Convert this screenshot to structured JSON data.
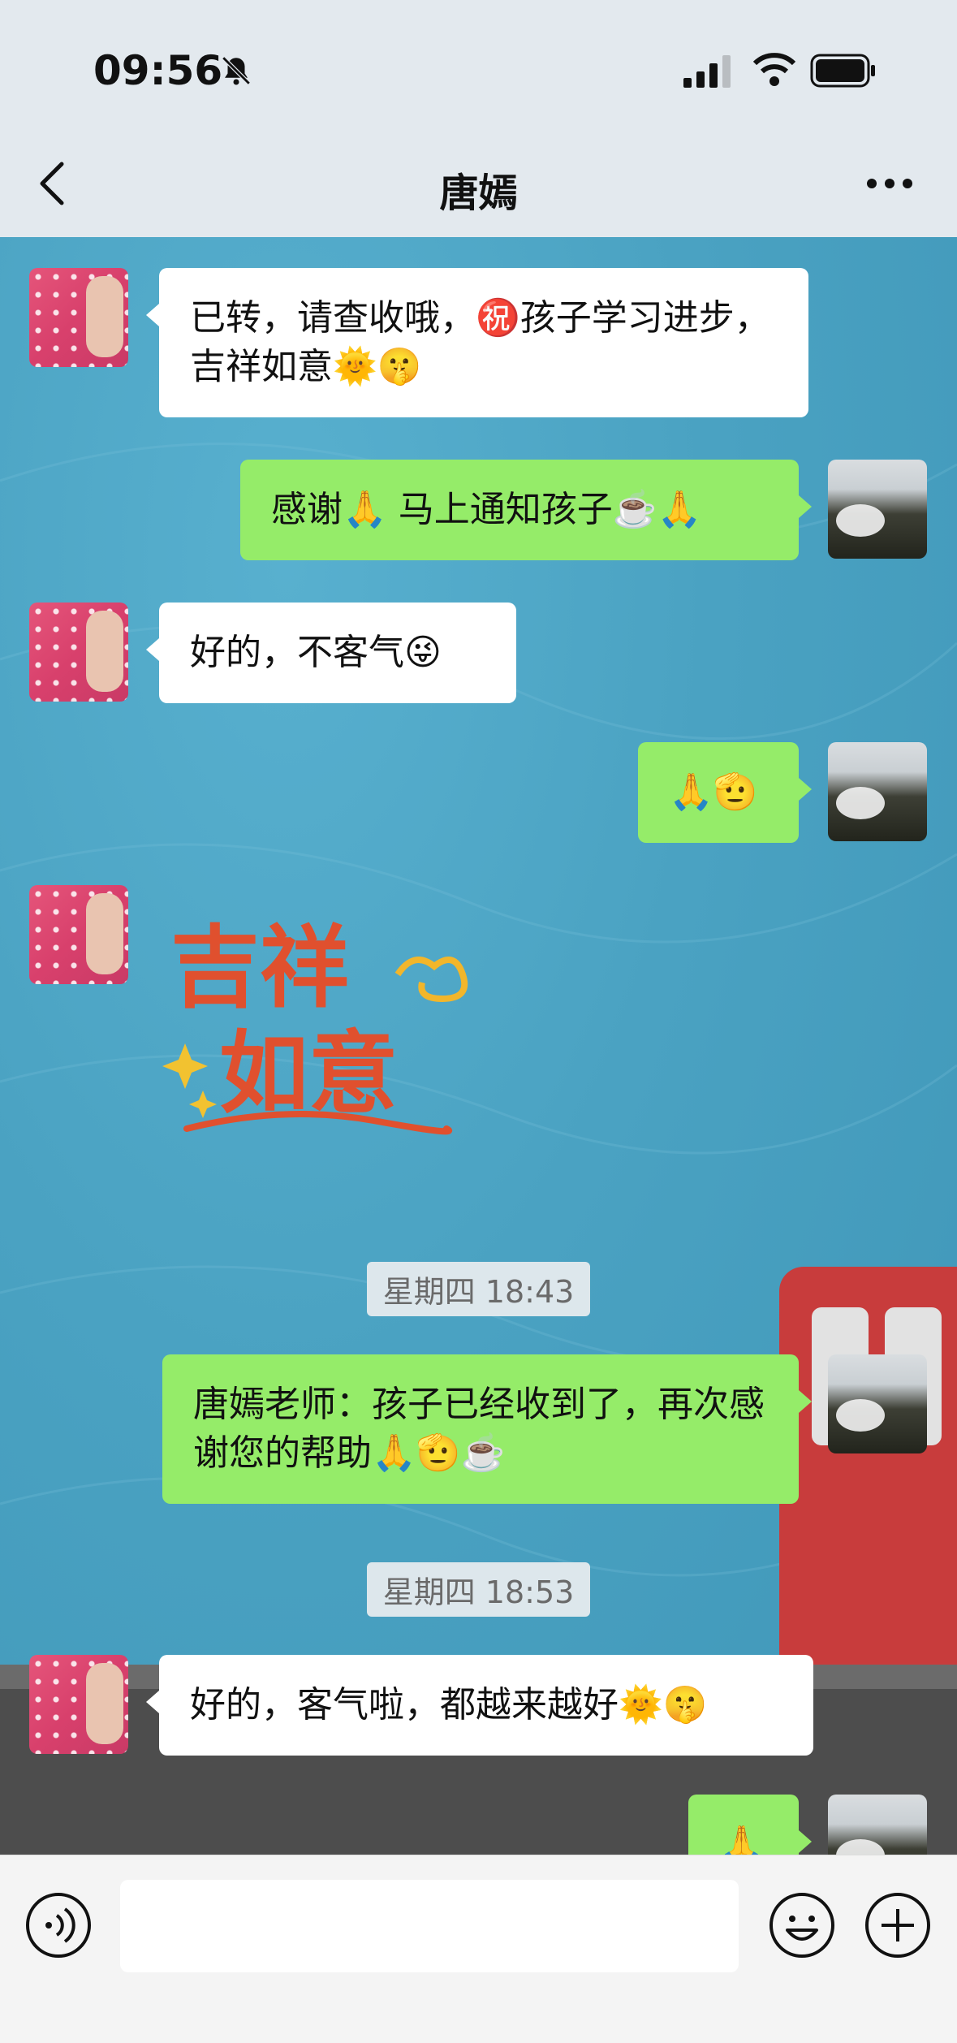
{
  "status_bar": {
    "time": "09:56"
  },
  "header": {
    "title": "唐嫣"
  },
  "messages": [
    {
      "side": "left",
      "text": "已转，请查收哦，㊗️孩子学习进步，吉祥如意🌞🤫"
    },
    {
      "side": "right",
      "text": "感谢🙏 马上通知孩子☕️🙏"
    },
    {
      "side": "left",
      "text": "好的，不客气😜"
    },
    {
      "side": "right",
      "text": "🙏🫡"
    },
    {
      "side": "left",
      "type": "sticker",
      "text": "吉祥如意"
    },
    {
      "type": "time",
      "text": "星期四 18:43"
    },
    {
      "side": "right",
      "text": "唐嫣老师：孩子已经收到了，再次感谢您的帮助🙏🫡☕️"
    },
    {
      "type": "time",
      "text": "星期四 18:53"
    },
    {
      "side": "left",
      "text": "好的，客气啦，都越来越好🌞🤫"
    },
    {
      "side": "right",
      "text": "🙏"
    }
  ],
  "colors": {
    "bubble_sent": "#95ec69",
    "bubble_received": "#ffffff",
    "background": "#4aa3c3"
  },
  "input": {
    "placeholder": ""
  }
}
